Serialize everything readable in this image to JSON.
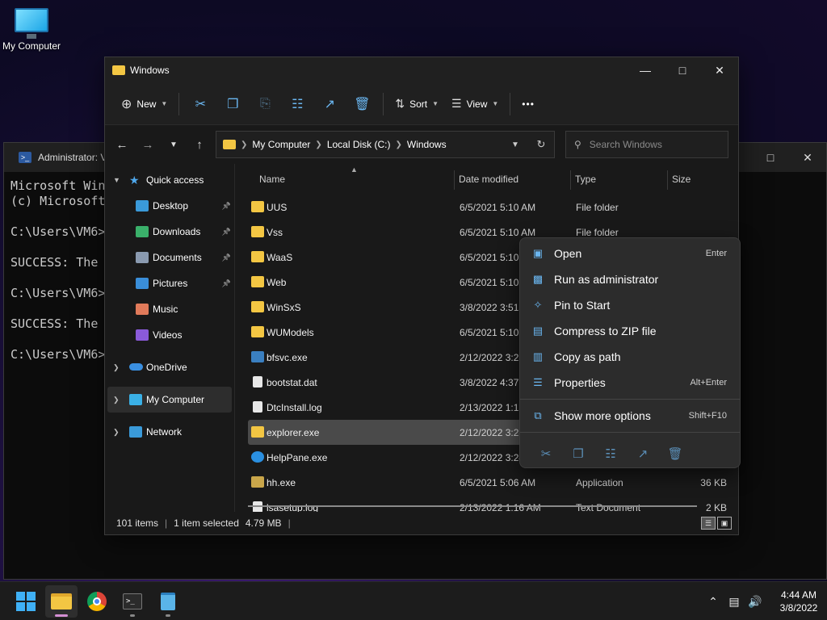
{
  "desktop": {
    "icon_label": "My Computer"
  },
  "terminal": {
    "tab_title": "Administrator: V",
    "lines": [
      "Microsoft Win",
      "(c) Microsoft",
      "",
      "C:\\Users\\VM6>",
      "",
      "SUCCESS: The",
      "",
      "C:\\Users\\VM6>",
      "",
      "SUCCESS: The",
      "",
      "C:\\Users\\VM6>"
    ]
  },
  "explorer": {
    "title": "Windows",
    "toolbar": {
      "new_label": "New",
      "sort_label": "Sort",
      "view_label": "View",
      "more_label": "•••"
    },
    "address": {
      "crumbs": [
        "My Computer",
        "Local Disk (C:)",
        "Windows"
      ]
    },
    "search": {
      "placeholder": "Search Windows"
    },
    "sidebar": {
      "quick_access": "Quick access",
      "items": [
        {
          "label": "Desktop",
          "icon": "desktop-icon",
          "color": "#3a9ad9",
          "pinned": true
        },
        {
          "label": "Downloads",
          "icon": "download-icon",
          "color": "#3ab06a",
          "pinned": true
        },
        {
          "label": "Documents",
          "icon": "documents-icon",
          "color": "#8a9ab0",
          "pinned": true
        },
        {
          "label": "Pictures",
          "icon": "pictures-icon",
          "color": "#3a8ed9",
          "pinned": true
        },
        {
          "label": "Music",
          "icon": "music-icon",
          "color": "#e07a5a",
          "pinned": false
        },
        {
          "label": "Videos",
          "icon": "videos-icon",
          "color": "#8a5ad9",
          "pinned": false
        }
      ],
      "onedrive": "OneDrive",
      "my_computer": "My Computer",
      "network": "Network"
    },
    "columns": {
      "name": "Name",
      "date": "Date modified",
      "type": "Type",
      "size": "Size"
    },
    "files": [
      {
        "name": "UUS",
        "date": "6/5/2021 5:10 AM",
        "type": "File folder",
        "size": "",
        "kind": "folder"
      },
      {
        "name": "Vss",
        "date": "6/5/2021 5:10 AM",
        "type": "File folder",
        "size": "",
        "kind": "folder"
      },
      {
        "name": "WaaS",
        "date": "6/5/2021 5:10 A",
        "type": "",
        "size": "",
        "kind": "folder"
      },
      {
        "name": "Web",
        "date": "6/5/2021 5:10 A",
        "type": "",
        "size": "",
        "kind": "folder"
      },
      {
        "name": "WinSxS",
        "date": "3/8/2022 3:51 A",
        "type": "",
        "size": "",
        "kind": "folder"
      },
      {
        "name": "WUModels",
        "date": "6/5/2021 5:10 A",
        "type": "",
        "size": "",
        "kind": "folder"
      },
      {
        "name": "bfsvc.exe",
        "date": "2/12/2022 3:23",
        "type": "",
        "size": "",
        "kind": "exe"
      },
      {
        "name": "bootstat.dat",
        "date": "3/8/2022 4:37 A",
        "type": "",
        "size": "",
        "kind": "file"
      },
      {
        "name": "DtcInstall.log",
        "date": "2/13/2022 1:17",
        "type": "",
        "size": "",
        "kind": "file"
      },
      {
        "name": "explorer.exe",
        "date": "2/12/2022 3:23",
        "type": "",
        "size": "",
        "kind": "explorer",
        "selected": true
      },
      {
        "name": "HelpPane.exe",
        "date": "2/12/2022 3:24",
        "type": "",
        "size": "",
        "kind": "help"
      },
      {
        "name": "hh.exe",
        "date": "6/5/2021 5:06 AM",
        "type": "Application",
        "size": "36 KB",
        "kind": "exe2"
      },
      {
        "name": "lsasetup.log",
        "date": "2/13/2022 1:16 AM",
        "type": "Text Document",
        "size": "2 KB",
        "kind": "file"
      }
    ],
    "status": {
      "count": "101 items",
      "selected": "1 item selected",
      "size": "4.79 MB"
    }
  },
  "context_menu": {
    "items": [
      {
        "label": "Open",
        "shortcut": "Enter",
        "icon": "open-icon"
      },
      {
        "label": "Run as administrator",
        "shortcut": "",
        "icon": "shield-icon"
      },
      {
        "label": "Pin to Start",
        "shortcut": "",
        "icon": "pin-icon"
      },
      {
        "label": "Compress to ZIP file",
        "shortcut": "",
        "icon": "zip-icon"
      },
      {
        "label": "Copy as path",
        "shortcut": "",
        "icon": "copy-path-icon"
      },
      {
        "label": "Properties",
        "shortcut": "Alt+Enter",
        "icon": "properties-icon"
      }
    ],
    "more": {
      "label": "Show more options",
      "shortcut": "Shift+F10",
      "icon": "more-options-icon"
    }
  },
  "taskbar": {
    "time": "4:44 AM",
    "date": "3/8/2022"
  },
  "colors": {
    "accent": "#6ab6f0",
    "folder": "#f3c643",
    "selection": "#4a4a4a"
  }
}
